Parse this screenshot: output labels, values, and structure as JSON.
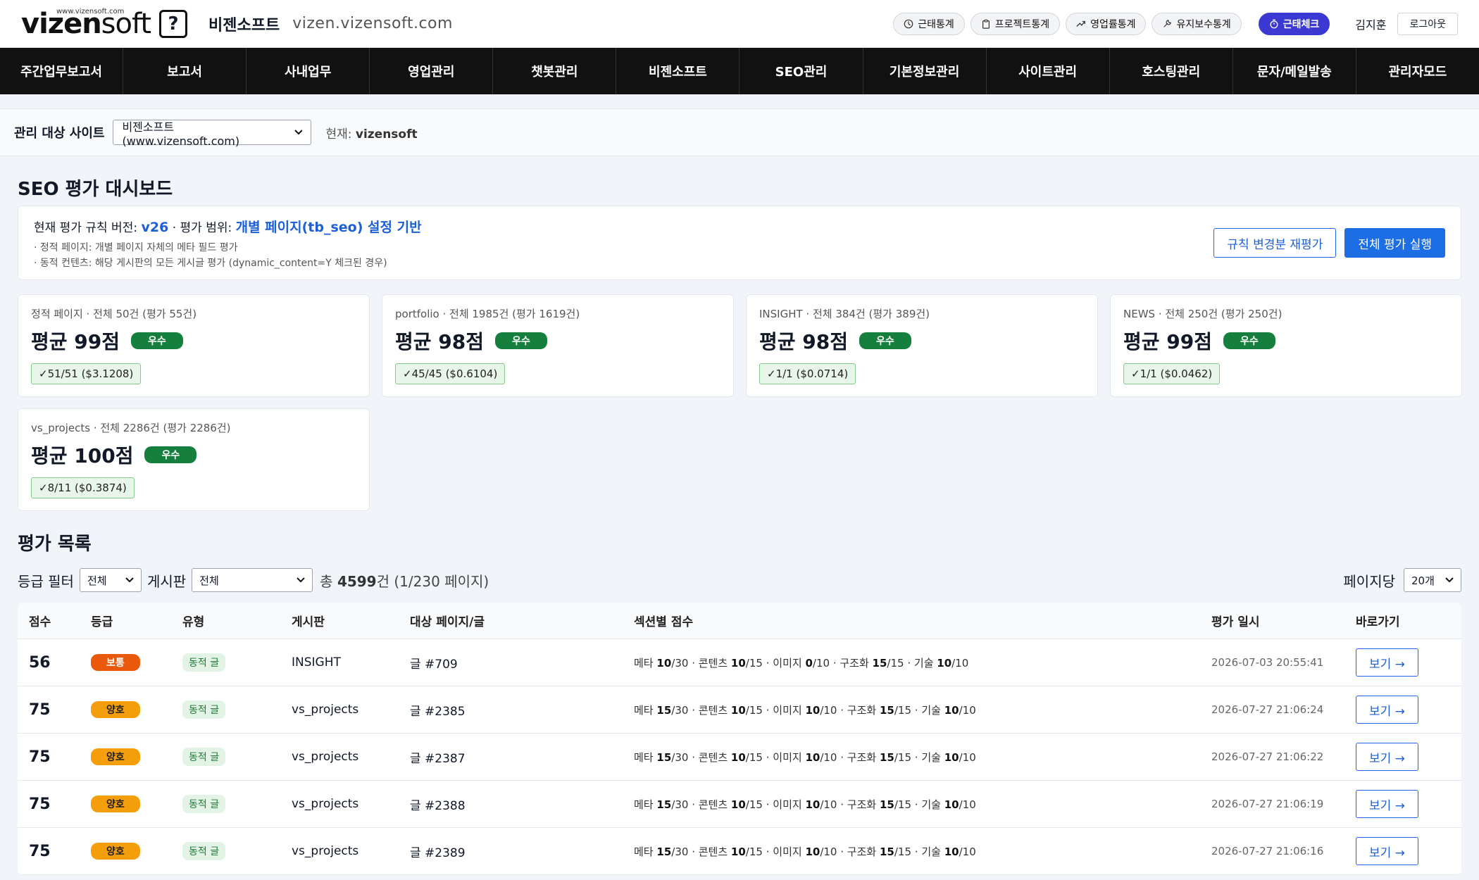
{
  "header": {
    "logo_url": "www.vizensoft.com",
    "logo_text_bold": "vizen",
    "logo_text_light": "soft",
    "logo_mark": "?",
    "brand": "비젠소프트",
    "domain": "vizen.vizensoft.com",
    "stats_buttons": [
      {
        "label": "근태통계",
        "icon": "clock-icon"
      },
      {
        "label": "프로젝트통계",
        "icon": "clipboard-icon"
      },
      {
        "label": "영업률통계",
        "icon": "trend-up-icon"
      },
      {
        "label": "유지보수통계",
        "icon": "wrench-icon"
      }
    ],
    "attendance_check": "근태체크",
    "user_name": "김지훈",
    "logout": "로그아웃"
  },
  "nav": [
    "주간업무보고서",
    "보고서",
    "사내업무",
    "영업관리",
    "챗봇관리",
    "비젠소프트",
    "SEO관리",
    "기본정보관리",
    "사이트관리",
    "호스팅관리",
    "문자/메일발송",
    "관리자모드"
  ],
  "sitebar": {
    "label": "관리 대상 사이트",
    "selected_site": "비젠소프트 (www.vizensoft.com)",
    "current_label": "현재:",
    "current_value": "vizensoft"
  },
  "page_title": "SEO 평가 대시보드",
  "info": {
    "version_label": "현재 평가 규칙 버전:",
    "version_value": "v26",
    "scope_label": "· 평가 범위:",
    "scope_value": "개별 페이지(tb_seo) 설정 기반",
    "note1": "· 정적 페이지: 개별 페이지 자체의 메타 필드 평가",
    "note2": "· 동적 컨텐츠: 해당 게시판의 모든 게시글 평가 (dynamic_content=Y 체크된 경우)",
    "btn_reeval": "규칙 변경분 재평가",
    "btn_run_all": "전체 평가 실행"
  },
  "cards": [
    {
      "head": "정적 페이지 · 전체 50건 (평가 55건)",
      "avg": "평균 99점",
      "badge": "우수",
      "stat": "✓51/51 ($3.1208)"
    },
    {
      "head": "portfolio · 전체 1985건 (평가 1619건)",
      "avg": "평균 98점",
      "badge": "우수",
      "stat": "✓45/45 ($0.6104)"
    },
    {
      "head": "INSIGHT · 전체 384건 (평가 389건)",
      "avg": "평균 98점",
      "badge": "우수",
      "stat": "✓1/1 ($0.0714)"
    },
    {
      "head": "NEWS · 전체 250건 (평가 250건)",
      "avg": "평균 99점",
      "badge": "우수",
      "stat": "✓1/1 ($0.0462)"
    },
    {
      "head": "vs_projects · 전체 2286건 (평가 2286건)",
      "avg": "평균 100점",
      "badge": "우수",
      "stat": "✓8/11 ($0.3874)"
    }
  ],
  "list": {
    "title": "평가 목록",
    "grade_filter_label": "등급 필터",
    "grade_filter_value": "전체",
    "board_label": "게시판",
    "board_value": "전체",
    "total_prefix": "총",
    "total_count": "4599",
    "total_suffix": "건 (1/230 페이지)",
    "per_page_label": "페이지당",
    "per_page_value": "20개",
    "columns": [
      "점수",
      "등급",
      "유형",
      "게시판",
      "대상 페이지/글",
      "섹션별 점수",
      "평가 일시",
      "바로가기"
    ],
    "rows": [
      {
        "score": "56",
        "grade": "보통",
        "grade_type": "normal",
        "type": "동적 글",
        "board": "INSIGHT",
        "target": "글 #709",
        "sections": [
          [
            "메타",
            "10",
            "30"
          ],
          [
            "콘텐츠",
            "10",
            "15"
          ],
          [
            "이미지",
            "0",
            "10"
          ],
          [
            "구조화",
            "15",
            "15"
          ],
          [
            "기술",
            "10",
            "10"
          ]
        ],
        "date": "2026-07-03 20:55:41",
        "link": "보기 →"
      },
      {
        "score": "75",
        "grade": "양호",
        "grade_type": "good",
        "type": "동적 글",
        "board": "vs_projects",
        "target": "글 #2385",
        "sections": [
          [
            "메타",
            "15",
            "30"
          ],
          [
            "콘텐츠",
            "10",
            "15"
          ],
          [
            "이미지",
            "10",
            "10"
          ],
          [
            "구조화",
            "15",
            "15"
          ],
          [
            "기술",
            "10",
            "10"
          ]
        ],
        "date": "2026-07-27 21:06:24",
        "link": "보기 →"
      },
      {
        "score": "75",
        "grade": "양호",
        "grade_type": "good",
        "type": "동적 글",
        "board": "vs_projects",
        "target": "글 #2387",
        "sections": [
          [
            "메타",
            "15",
            "30"
          ],
          [
            "콘텐츠",
            "10",
            "15"
          ],
          [
            "이미지",
            "10",
            "10"
          ],
          [
            "구조화",
            "15",
            "15"
          ],
          [
            "기술",
            "10",
            "10"
          ]
        ],
        "date": "2026-07-27 21:06:22",
        "link": "보기 →"
      },
      {
        "score": "75",
        "grade": "양호",
        "grade_type": "good",
        "type": "동적 글",
        "board": "vs_projects",
        "target": "글 #2388",
        "sections": [
          [
            "메타",
            "15",
            "30"
          ],
          [
            "콘텐츠",
            "10",
            "15"
          ],
          [
            "이미지",
            "10",
            "10"
          ],
          [
            "구조화",
            "15",
            "15"
          ],
          [
            "기술",
            "10",
            "10"
          ]
        ],
        "date": "2026-07-27 21:06:19",
        "link": "보기 →"
      },
      {
        "score": "75",
        "grade": "양호",
        "grade_type": "good",
        "type": "동적 글",
        "board": "vs_projects",
        "target": "글 #2389",
        "sections": [
          [
            "메타",
            "15",
            "30"
          ],
          [
            "콘텐츠",
            "10",
            "15"
          ],
          [
            "이미지",
            "10",
            "10"
          ],
          [
            "구조화",
            "15",
            "15"
          ],
          [
            "기술",
            "10",
            "10"
          ]
        ],
        "date": "2026-07-27 21:06:16",
        "link": "보기 →"
      }
    ]
  },
  "colors": {
    "accent": "#1d6ee5",
    "attendance_button": "#3b39d1",
    "badge_excellent": "#15803d",
    "badge_normal": "#ea580c",
    "badge_good": "#f59e0b"
  }
}
